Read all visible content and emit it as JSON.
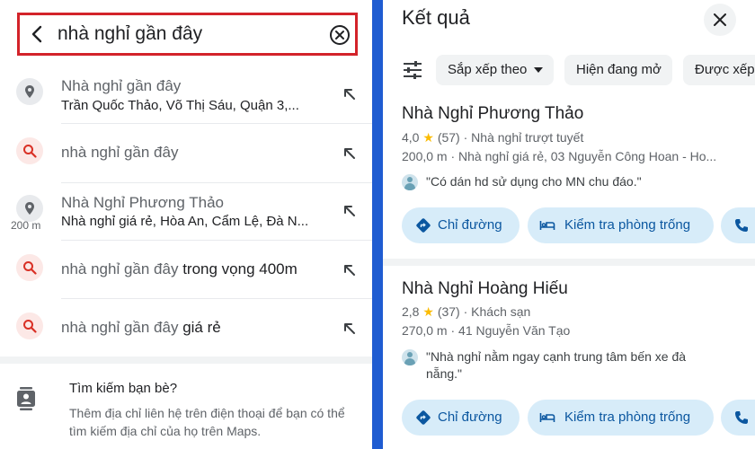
{
  "search": {
    "query": "nhà nghỉ gần đây"
  },
  "suggestions": [
    {
      "type": "place",
      "title": "Nhà nghỉ gần đây",
      "subtitle": "Trần Quốc Thảo, Võ Thị Sáu, Quận 3,..."
    },
    {
      "type": "search",
      "prefix": "nhà nghỉ gần đây",
      "suffix": ""
    },
    {
      "type": "place",
      "title": "Nhà Nghỉ Phương Thảo",
      "subtitle": "Nhà nghỉ giá rẻ, Hòa An, Cẩm Lệ, Đà N...",
      "distance": "200 m"
    },
    {
      "type": "search",
      "prefix": "nhà nghỉ gần đây",
      "suffix": "trong vọng 400m"
    },
    {
      "type": "search",
      "prefix": "nhà nghỉ gần đây",
      "suffix": "giá rẻ"
    }
  ],
  "friends": {
    "title": "Tìm kiếm bạn bè?",
    "description": "Thêm địa chỉ liên hệ trên điện thoại để bạn có thể tìm kiếm địa chỉ của họ trên Maps."
  },
  "results": {
    "title": "Kết quả",
    "chips": [
      "Sắp xếp theo",
      "Hiện đang mở",
      "Được xếp"
    ],
    "cards": [
      {
        "name": "Nhà Nghỉ Phương Thảo",
        "rating": "4,0",
        "reviews": "(57)",
        "category": "Nhà nghỉ trượt tuyết",
        "line2": "200,0 m · Nhà nghỉ giá rẻ, 03 Nguyễn Công Hoan - Ho...",
        "review": "\"Có dán hd sử dụng cho MN chu đáo.\"",
        "btn_directions": "Chỉ đường",
        "btn_rooms": "Kiểm tra phòng trống"
      },
      {
        "name": "Nhà Nghỉ Hoàng Hiếu",
        "rating": "2,8",
        "reviews": "(37)",
        "category": "Khách sạn",
        "line2": "270,0 m · 41 Nguyễn Văn Tạo",
        "review": "\"Nhà nghỉ nằm ngay cạnh trung tâm bến xe đà nẵng.\"",
        "btn_directions": "Chỉ đường",
        "btn_rooms": "Kiểm tra phòng trống"
      }
    ]
  },
  "colors": {
    "highlight_border": "#d3232a",
    "panel_separator": "#1f5cd1",
    "action_button_bg": "#d7ecf9",
    "action_button_text": "#0b57a0",
    "star": "#fbbc04"
  },
  "icons": [
    "back-arrow-icon",
    "clear-icon",
    "pin-icon",
    "search-icon",
    "north-west-arrow-icon",
    "contacts-icon",
    "close-icon",
    "filter-icon",
    "directions-icon",
    "bed-icon",
    "phone-icon",
    "star-icon"
  ]
}
